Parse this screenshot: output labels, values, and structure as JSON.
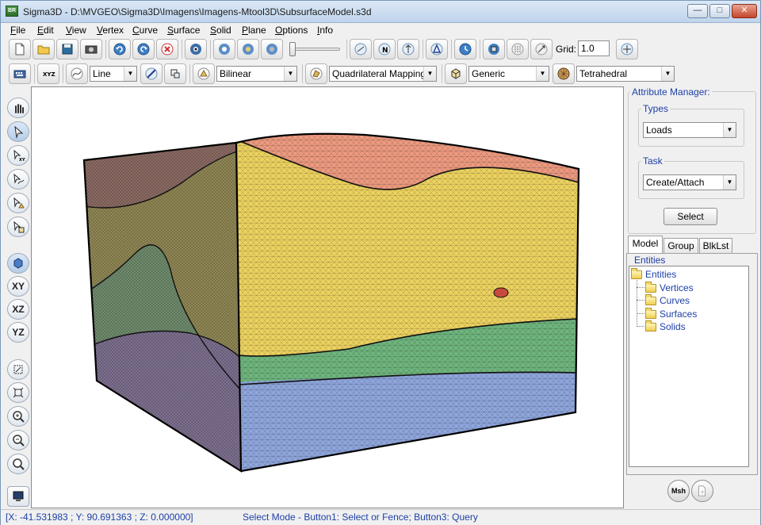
{
  "window": {
    "title": "Sigma3D - D:\\MVGEO\\Sigma3D\\Imagens\\Imagens-Mtool3D\\SubsurfaceModel.s3d",
    "app_icon_text": "BR"
  },
  "menu": [
    {
      "first": "F",
      "rest": "ile"
    },
    {
      "first": "E",
      "rest": "dit"
    },
    {
      "first": "V",
      "rest": "iew"
    },
    {
      "first": "V",
      "rest": "ertex"
    },
    {
      "first": "C",
      "rest": "urve"
    },
    {
      "first": "S",
      "rest": "urface"
    },
    {
      "first": "S",
      "rest": "olid"
    },
    {
      "first": "P",
      "rest": "lane"
    },
    {
      "first": "O",
      "rest": "ptions"
    },
    {
      "first": "I",
      "rest": "nfo"
    }
  ],
  "toolbar1": {
    "grid_label": "Grid:",
    "grid_value": "1.0"
  },
  "toolbar2": {
    "curve_type": "Line",
    "interpolation": "Bilinear",
    "mapping": "Quadrilateral Mapping",
    "solid_type": "Generic",
    "mesh_type": "Tetrahedral"
  },
  "left_tools": {
    "xy": "XY",
    "xz": "XZ",
    "yz": "YZ"
  },
  "attribute_manager": {
    "title": "Attribute Manager:",
    "types_label": "Types",
    "types_value": "Loads",
    "task_label": "Task",
    "task_value": "Create/Attach",
    "select_button": "Select"
  },
  "tabs": [
    "Model",
    "Group",
    "BlkLst"
  ],
  "entities": {
    "label": "Entities",
    "root": "Entities",
    "children": [
      "Vertices",
      "Curves",
      "Surfaces",
      "Solids"
    ]
  },
  "bottom_buttons": {
    "msh": "Msh"
  },
  "status": {
    "coords": "[X: -41.531983 ; Y: 90.691363 ; Z: 0.000000]",
    "mode": "Select Mode - Button1: Select or Fence; Button3: Query"
  },
  "colors": {
    "salmon_layer": "#ec9a80",
    "yellow_layer": "#ecd260",
    "green_layer": "#6fb57e",
    "blue_layer": "#8fa6dc",
    "accent_blue": "#1d3fa6"
  }
}
